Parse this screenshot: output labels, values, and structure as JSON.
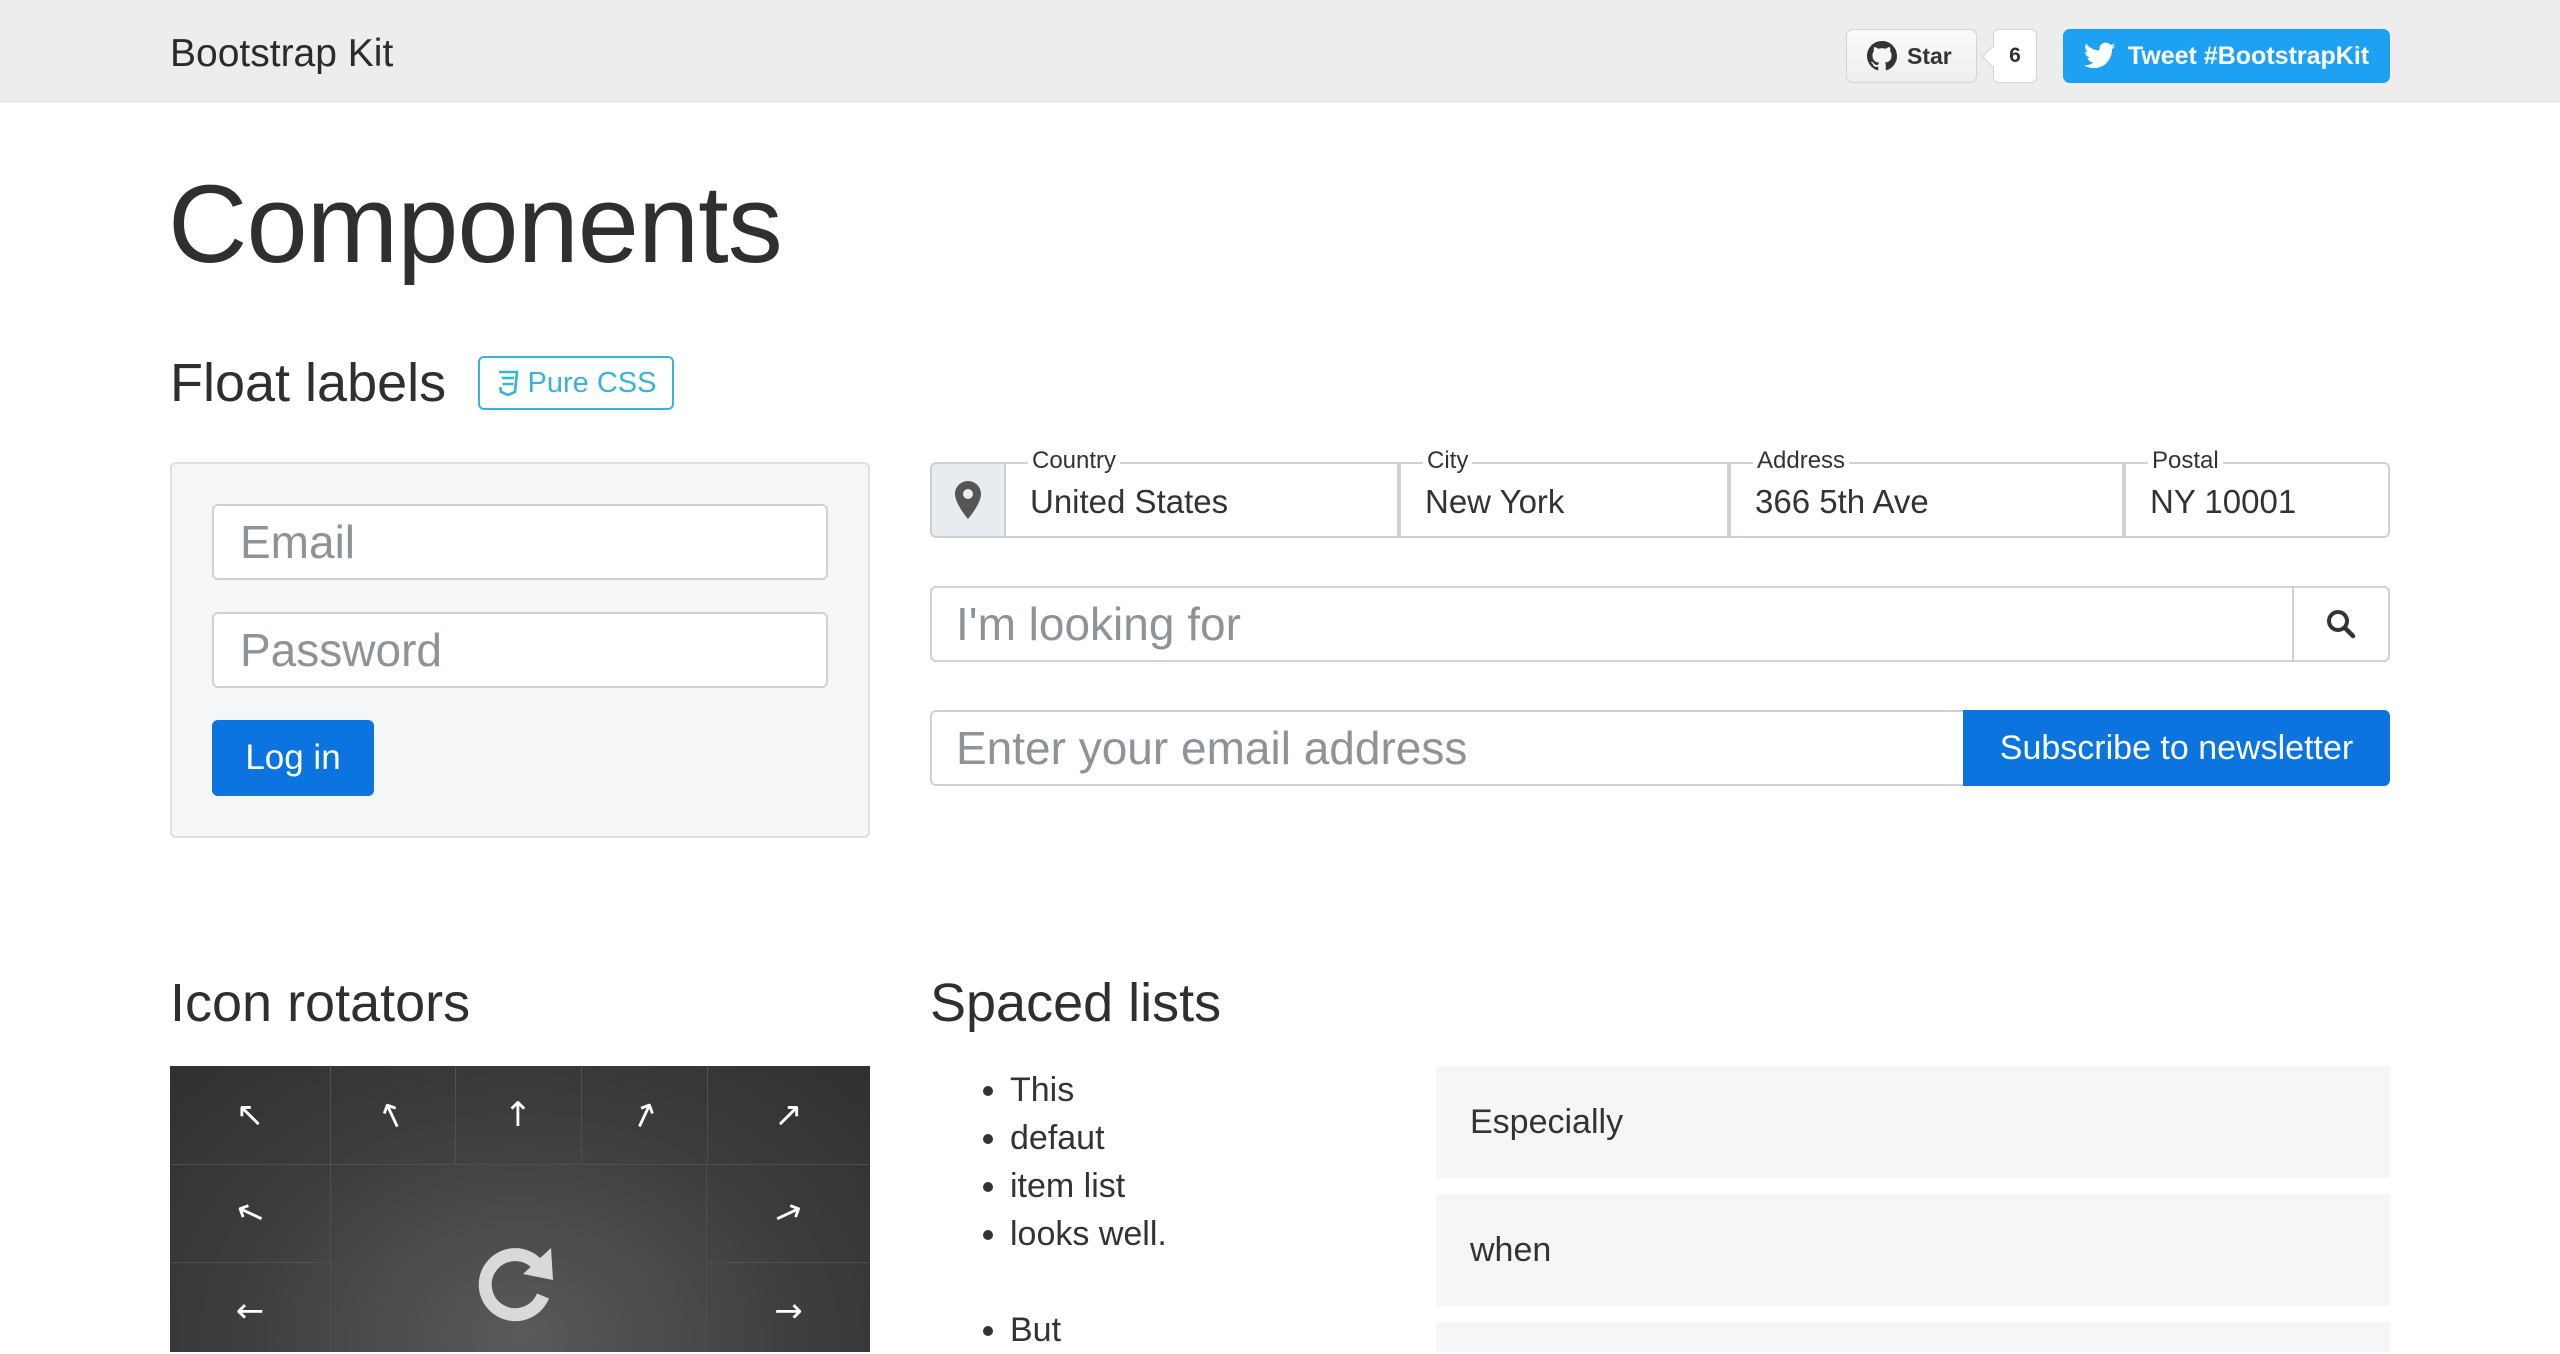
{
  "navbar": {
    "brand": "Bootstrap Kit",
    "star_label": "Star",
    "star_count": "6",
    "tweet_label": "Tweet #BootstrapKit"
  },
  "page_title": "Components",
  "float_labels": {
    "heading": "Float labels",
    "badge": "Pure CSS",
    "login": {
      "email_placeholder": "Email",
      "password_placeholder": "Password",
      "login_button": "Log in"
    },
    "address": {
      "fields": [
        {
          "label": "Country",
          "value": "United States"
        },
        {
          "label": "City",
          "value": "New York"
        },
        {
          "label": "Address",
          "value": "366 5th Ave"
        },
        {
          "label": "Postal",
          "value": "NY 10001"
        }
      ]
    },
    "search_placeholder": "I'm looking for",
    "newsletter": {
      "email_placeholder": "Enter your email address",
      "button": "Subscribe to newsletter"
    }
  },
  "icon_rotators": {
    "heading": "Icon rotators",
    "arrows": [
      "↖",
      "↖",
      "↑",
      "↗",
      "↗",
      "↖",
      "↗",
      "←",
      "→"
    ],
    "center_icon": "⟳"
  },
  "spaced_lists": {
    "heading": "Spaced lists",
    "group1": [
      "This",
      "defaut",
      "item list",
      "looks well."
    ],
    "group2": [
      "But"
    ],
    "grey_items": [
      "Especially",
      "when"
    ]
  }
}
